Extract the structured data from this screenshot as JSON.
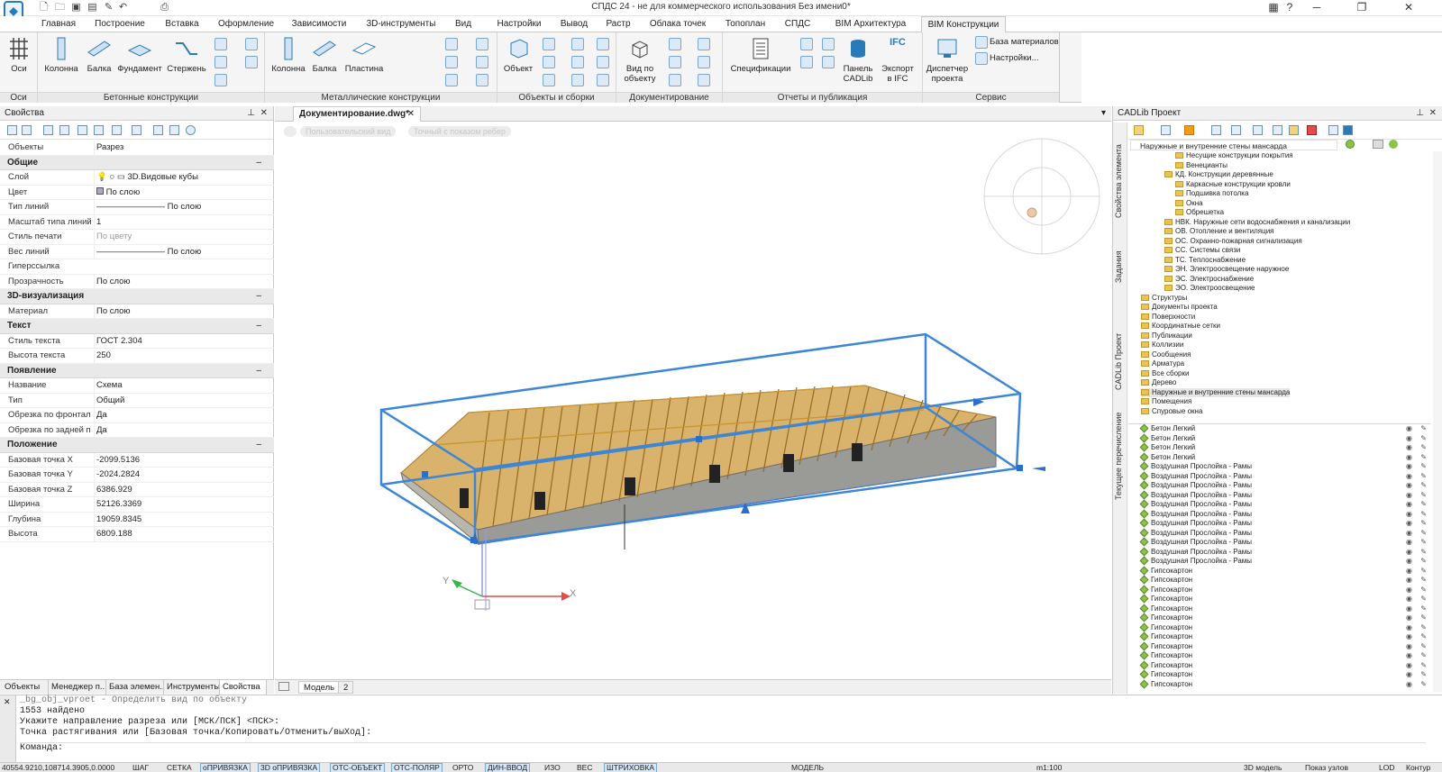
{
  "window": {
    "title": "СПДС 24 - не для коммерческого использования Без имени0*",
    "help": "?"
  },
  "ribbon_tabs": [
    "Главная",
    "Построение",
    "Вставка",
    "Оформление",
    "Зависимости",
    "3D-инструменты",
    "Вид",
    "Настройки",
    "Вывод",
    "Растр",
    "Облака точек",
    "Топоплан",
    "СПДС",
    "BIM Архитектура",
    "BIM Конструкции"
  ],
  "ribbon": {
    "groups": [
      "Оси",
      "Бетонные конструкции",
      "Металлические конструкции",
      "Объекты и сборки",
      "Документирование",
      "Отчеты и публикация",
      "Сервис"
    ],
    "axes": "Оси",
    "concrete": [
      "Колонна",
      "Балка",
      "Фундамент",
      "Стержень"
    ],
    "metal": [
      "Колонна",
      "Балка",
      "Пластина"
    ],
    "objects": [
      "Объект"
    ],
    "doc": [
      "Вид по",
      "объекту"
    ],
    "reports": {
      "spec": "Спецификации",
      "panel1": "Панель",
      "panel2": "CADLib",
      "export1": "Экспорт",
      "export2": "в IFC",
      "ifc": "IFC",
      "disp1": "Диспетчер",
      "disp2": "проекта"
    },
    "service": [
      "База материалов",
      "Настройки..."
    ]
  },
  "props": {
    "title": "Свойства",
    "objects_label": "Объекты",
    "objects_value": "Разрез",
    "sections": [
      {
        "name": "Общие",
        "rows": [
          [
            "Слой",
            "3D.Видовые кубы"
          ],
          [
            "Цвет",
            "По слою"
          ],
          [
            "Тип линий",
            "По слою"
          ],
          [
            "Масштаб типа линий",
            "1"
          ],
          [
            "Стиль печати",
            "По цвету"
          ],
          [
            "Вес линий",
            "По слою"
          ],
          [
            "Гиперссылка",
            ""
          ],
          [
            "Прозрачность",
            "По слою"
          ]
        ]
      },
      {
        "name": "3D-визуализация",
        "rows": [
          [
            "Материал",
            "По слою"
          ]
        ]
      },
      {
        "name": "Текст",
        "rows": [
          [
            "Стиль текста",
            "ГОСТ 2.304"
          ],
          [
            "Высота текста",
            "250"
          ]
        ]
      },
      {
        "name": "Появление",
        "rows": [
          [
            "Название",
            "Схема"
          ],
          [
            "Тип",
            "Общий"
          ],
          [
            "Обрезка по фронтал...",
            "Да"
          ],
          [
            "Обрезка по задней п...",
            "Да"
          ]
        ]
      },
      {
        "name": "Положение",
        "rows": [
          [
            "Базовая точка X",
            "-2099.5136"
          ],
          [
            "Базовая точка Y",
            "-2024.2824"
          ],
          [
            "Базовая точка Z",
            "6386.929"
          ],
          [
            "Ширина",
            "52126.3369"
          ],
          [
            "Глубина",
            "19059.8345"
          ],
          [
            "Высота",
            "6809.188"
          ]
        ]
      }
    ],
    "tabs": [
      "Объекты",
      "Менеджер п...",
      "База элемен...",
      "Инструменты",
      "Свойства"
    ]
  },
  "doc": {
    "tab": "Документирование.dwg*",
    "close": "✕",
    "view_pills": [
      "Пользовательский вид",
      "Точный с показом ребер"
    ],
    "model_tabs": [
      "Модель",
      "2"
    ],
    "axis_x": "X",
    "axis_y": "Y"
  },
  "cadlib": {
    "title": "CADLib Проект",
    "vtabs": [
      "Свойства элемента",
      "Задания",
      "CADLib Проект",
      "Текущее перечисление"
    ],
    "search": "Наружные и внутренние стены мансарда",
    "tree": [
      "Несущие конструкции покрытия",
      "Венецианты",
      "КД. Конструкции деревянные",
      "Каркасные конструкции кровли",
      "Подшивка потолка",
      "Окна",
      "Обрешетка",
      "НВК. Наружные сети водоснабжения и канализации",
      "ОВ. Отопление и вентиляция",
      "ОС. Охранно-пожарная сигнализация",
      "СС. Системы связи",
      "ТС. Теплоснабжение",
      "ЭН. Электроосвещение наружное",
      "ЭС. Электроснабжение",
      "ЭО. Электроосвещение",
      "Структуры",
      "Документы проекта",
      "Поверхности",
      "Координатные сетки",
      "Публикации",
      "Коллизии",
      "Сообщения",
      "Арматура",
      "Все сборки",
      "Дерево",
      "Наружные и внутренние стены мансарда",
      "Помещения",
      "Спуровые окна"
    ],
    "layers": [
      "Бетон Легкий",
      "Бетон Легкий",
      "Бетон Легкий",
      "Бетон Легкий",
      "Воздушная Прослойка - Рамы",
      "Воздушная Прослойка - Рамы",
      "Воздушная Прослойка - Рамы",
      "Воздушная Прослойка - Рамы",
      "Воздушная Прослойка - Рамы",
      "Воздушная Прослойка - Рамы",
      "Воздушная Прослойка - Рамы",
      "Воздушная Прослойка - Рамы",
      "Воздушная Прослойка - Рамы",
      "Воздушная Прослойка - Рамы",
      "Воздушная Прослойка - Рамы",
      "Гипсокартон",
      "Гипсокартон",
      "Гипсокартон",
      "Гипсокартон",
      "Гипсокартон",
      "Гипсокартон",
      "Гипсокартон",
      "Гипсокартон",
      "Гипсокартон",
      "Гипсокартон",
      "Гипсокартон",
      "Гипсокартон",
      "Гипсокартон"
    ]
  },
  "command": {
    "lines": [
      "_bg_obj_vproet - Определить вид по объекту",
      "1553 найдено",
      "Укажите направление разреза или [МСК/ПСК] <ПСК>:",
      "Точка растягивания или [Базовая точка/Копировать/Отменить/выХод]:",
      "Команда:"
    ]
  },
  "status": {
    "coords": "40554.9210,108714.3905,0.0000",
    "buttons": [
      "ШАГ",
      "СЕТКА",
      "оПРИВЯЗКА",
      "3D оПРИВЯЗКА",
      "ОТС-ОБЪЕКТ",
      "ОТС-ПОЛЯР",
      "ОРТО",
      "ДИН-ВВОД",
      "ИЗО",
      "ВЕС",
      "ШТРИХОВКА"
    ],
    "model": "МОДЕЛЬ",
    "scale": "m1:100",
    "mode3d": "3D модель",
    "nodes": "Показ узлов",
    "lod": "LOD",
    "contour": "Контур"
  },
  "colors": {
    "selection": "#3d86d6",
    "wood": "#e0b15a",
    "accent": "#2a7ab8"
  }
}
